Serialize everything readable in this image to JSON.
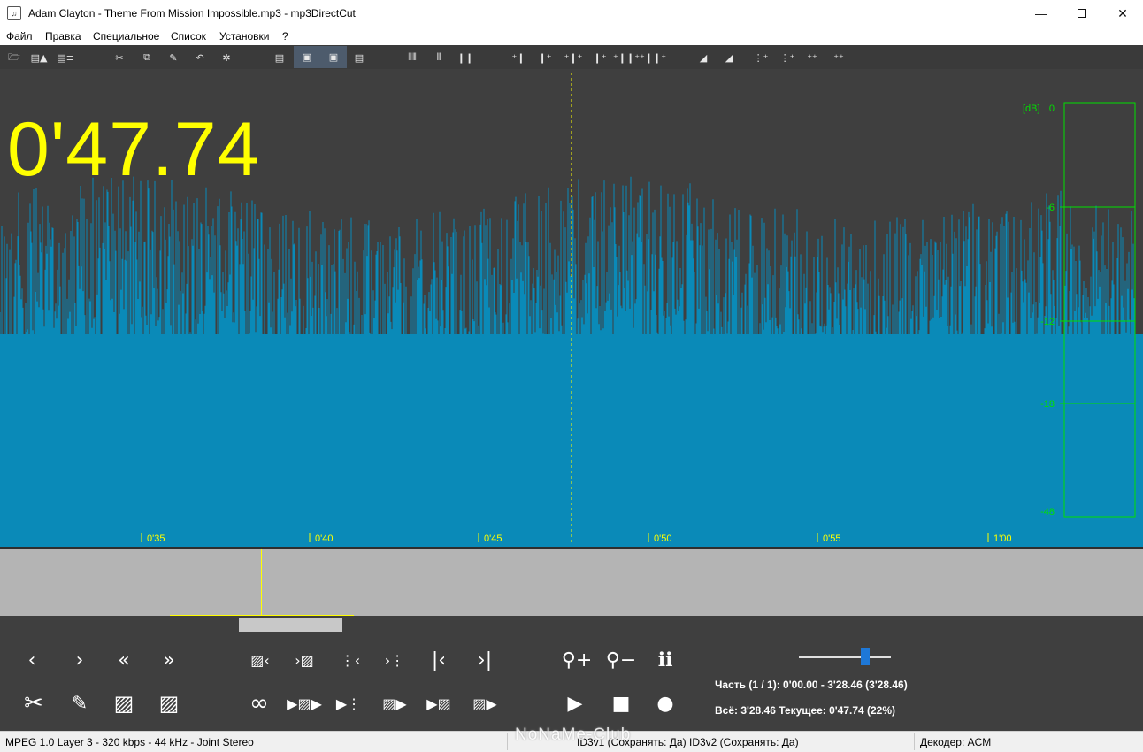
{
  "window": {
    "title": "Adam Clayton - Theme From Mission Impossible.mp3 - mp3DirectCut",
    "app_icon": "mp3directcut-icon"
  },
  "menu": [
    "Файл",
    "Правка",
    "Специальное",
    "Список",
    "Установки",
    "?"
  ],
  "toolbar": {
    "icons": [
      "open-icon",
      "save-icon",
      "save-all-icon",
      "cut-icon",
      "copy-icon",
      "paste-icon",
      "undo-icon",
      "settings-icon",
      "doc-icon",
      "doc-1-icon",
      "doc-2-icon",
      "doc-3-icon",
      "cue-icon",
      "cue2-icon",
      "pause-icon",
      "marker-icons"
    ]
  },
  "waveform": {
    "time_readout": "0'47.74",
    "wave_color": "#0a8ab8",
    "timeline_labels": [
      "0'35",
      "0'40",
      "0'45",
      "0'50",
      "0'55",
      "1'00"
    ],
    "meter": {
      "unit_label": "[dB]",
      "labels": [
        "0",
        "-6",
        "-12",
        "-18",
        "-48"
      ],
      "color": "#00e000"
    }
  },
  "info": {
    "part": "Часть (1 / 1): 0'00.00 - 3'28.46 (3'28.46)",
    "total": "Всё: 3'28.46   Текущее: 0'47.74   (22%)",
    "zoom_level": 0.73
  },
  "status": {
    "format": "MPEG 1.0 Layer 3  -  320 kbps  -  44 kHz  -  Joint Stereo",
    "id3v1": "ID3v1 (Сохранять: Да)",
    "id3v2": "ID3v2 (Сохранять: Да)",
    "decoder": "Декодер: ACM"
  },
  "watermark": "NoNaMe-Club"
}
